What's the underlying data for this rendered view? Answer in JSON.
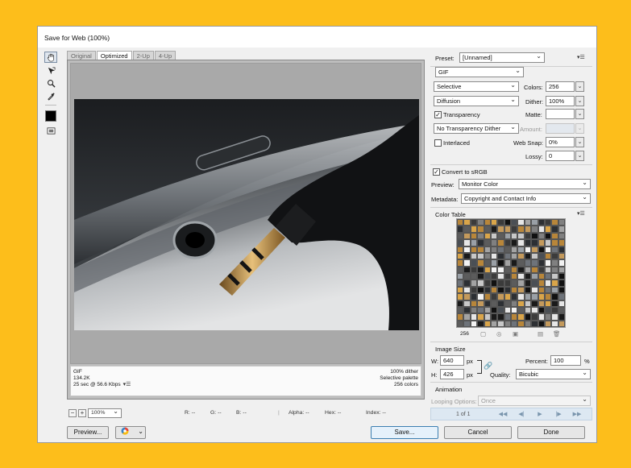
{
  "window": {
    "title": "Save for Web (100%)"
  },
  "tools": [
    "hand-tool",
    "slice-select-tool",
    "zoom-tool",
    "eyedropper-tool"
  ],
  "tabs": [
    {
      "label": "Original",
      "active": false
    },
    {
      "label": "Optimized",
      "active": true
    },
    {
      "label": "2-Up",
      "active": false
    },
    {
      "label": "4-Up",
      "active": false
    }
  ],
  "info": {
    "format": "GIF",
    "size": "134.2K",
    "speed": "25 sec @ 56.6 Kbps",
    "dither": "100% dither",
    "palette": "Selective palette",
    "colors": "256 colors"
  },
  "status": {
    "zoom": "100%",
    "r": "R: --",
    "g": "G: --",
    "b": "B: --",
    "alpha": "Alpha: --",
    "hex": "Hex: --",
    "index": "Index: --"
  },
  "buttons": {
    "preview": "Preview...",
    "save": "Save...",
    "cancel": "Cancel",
    "done": "Done"
  },
  "settings": {
    "preset_label": "Preset:",
    "preset_value": "[Unnamed]",
    "format_value": "GIF",
    "reduction_value": "Selective",
    "colors_label": "Colors:",
    "colors_value": "256",
    "dither_algo_value": "Diffusion",
    "dither_label": "Dither:",
    "dither_value": "100%",
    "transparency_label": "Transparency",
    "transparency_checked": true,
    "matte_label": "Matte:",
    "transparency_dither_value": "No Transparency Dither",
    "amount_label": "Amount:",
    "interlaced_label": "Interlaced",
    "interlaced_checked": false,
    "websnap_label": "Web Snap:",
    "websnap_value": "0%",
    "lossy_label": "Lossy:",
    "lossy_value": "0",
    "srgb_label": "Convert to sRGB",
    "srgb_checked": true,
    "preview_label": "Preview:",
    "preview_value": "Monitor Color",
    "metadata_label": "Metadata:",
    "metadata_value": "Copyright and Contact Info"
  },
  "color_table": {
    "title": "Color Table",
    "count": "256",
    "palette": [
      "#1a1a1a",
      "#3b3b3b",
      "#5c5c5c",
      "#808080",
      "#a3a3a3",
      "#c8c8c8",
      "#e6e6e6",
      "#b8863a",
      "#d9a54a",
      "#4a4f55",
      "#2c2f33",
      "#6e737a",
      "#9aa0a6",
      "#f2f2f2",
      "#111111",
      "#c49a5c"
    ]
  },
  "image_size": {
    "title": "Image Size",
    "w_label": "W:",
    "w_value": "640",
    "h_label": "H:",
    "h_value": "426",
    "unit": "px",
    "percent_label": "Percent:",
    "percent_value": "100",
    "percent_unit": "%",
    "quality_label": "Quality:",
    "quality_value": "Bicubic"
  },
  "animation": {
    "title": "Animation",
    "looping_label": "Looping Options:",
    "looping_value": "Once",
    "frame": "1 of 1"
  }
}
